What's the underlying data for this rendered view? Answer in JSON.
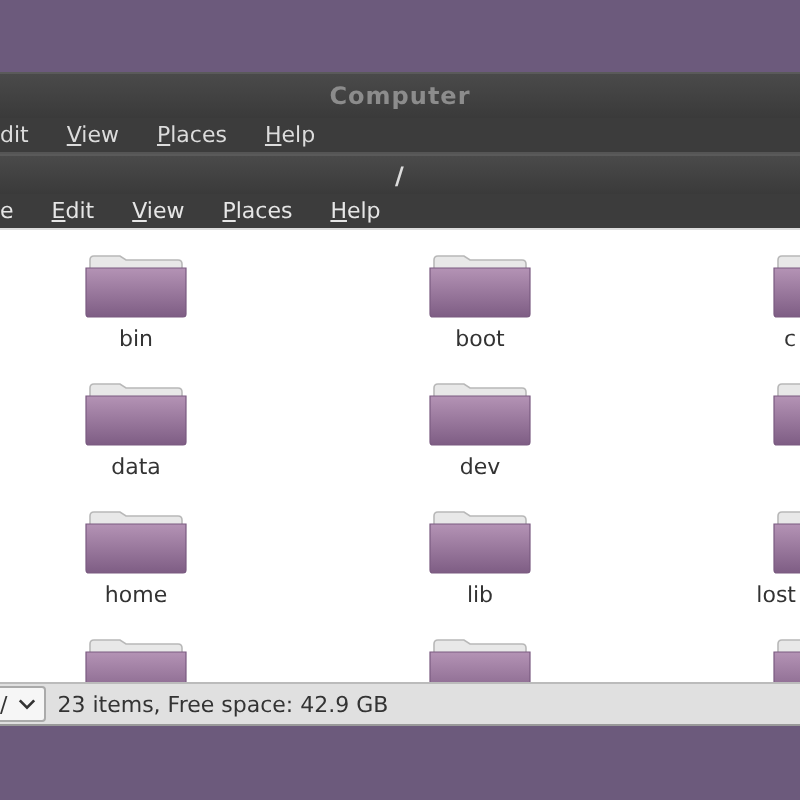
{
  "back_window": {
    "title": "Computer",
    "menu": [
      {
        "label": "dit",
        "underlined": false
      },
      {
        "label": "View",
        "underlined": true
      },
      {
        "label": "Places",
        "underlined": true
      },
      {
        "label": "Help",
        "underlined": true
      }
    ]
  },
  "window": {
    "title": "/",
    "menu": [
      {
        "label": "e",
        "underlined": false
      },
      {
        "label": "Edit",
        "underlined": true
      },
      {
        "label": "View",
        "underlined": true
      },
      {
        "label": "Places",
        "underlined": true
      },
      {
        "label": "Help",
        "underlined": true
      }
    ],
    "items": [
      {
        "kind": "folder",
        "name": "bin"
      },
      {
        "kind": "folder",
        "name": "boot"
      },
      {
        "kind": "folder",
        "name": "c"
      },
      {
        "kind": "folder",
        "name": "data"
      },
      {
        "kind": "folder",
        "name": "dev"
      },
      {
        "kind": "folder"
      },
      {
        "kind": "folder",
        "name": "home"
      },
      {
        "kind": "folder",
        "name": "lib"
      },
      {
        "kind": "folder",
        "name": "lost"
      },
      {
        "kind": "folder"
      },
      {
        "kind": "folder"
      },
      {
        "kind": "folder"
      }
    ],
    "status_bar": {
      "location": "/",
      "text": "23 items, Free space: 42.9 GB"
    }
  }
}
